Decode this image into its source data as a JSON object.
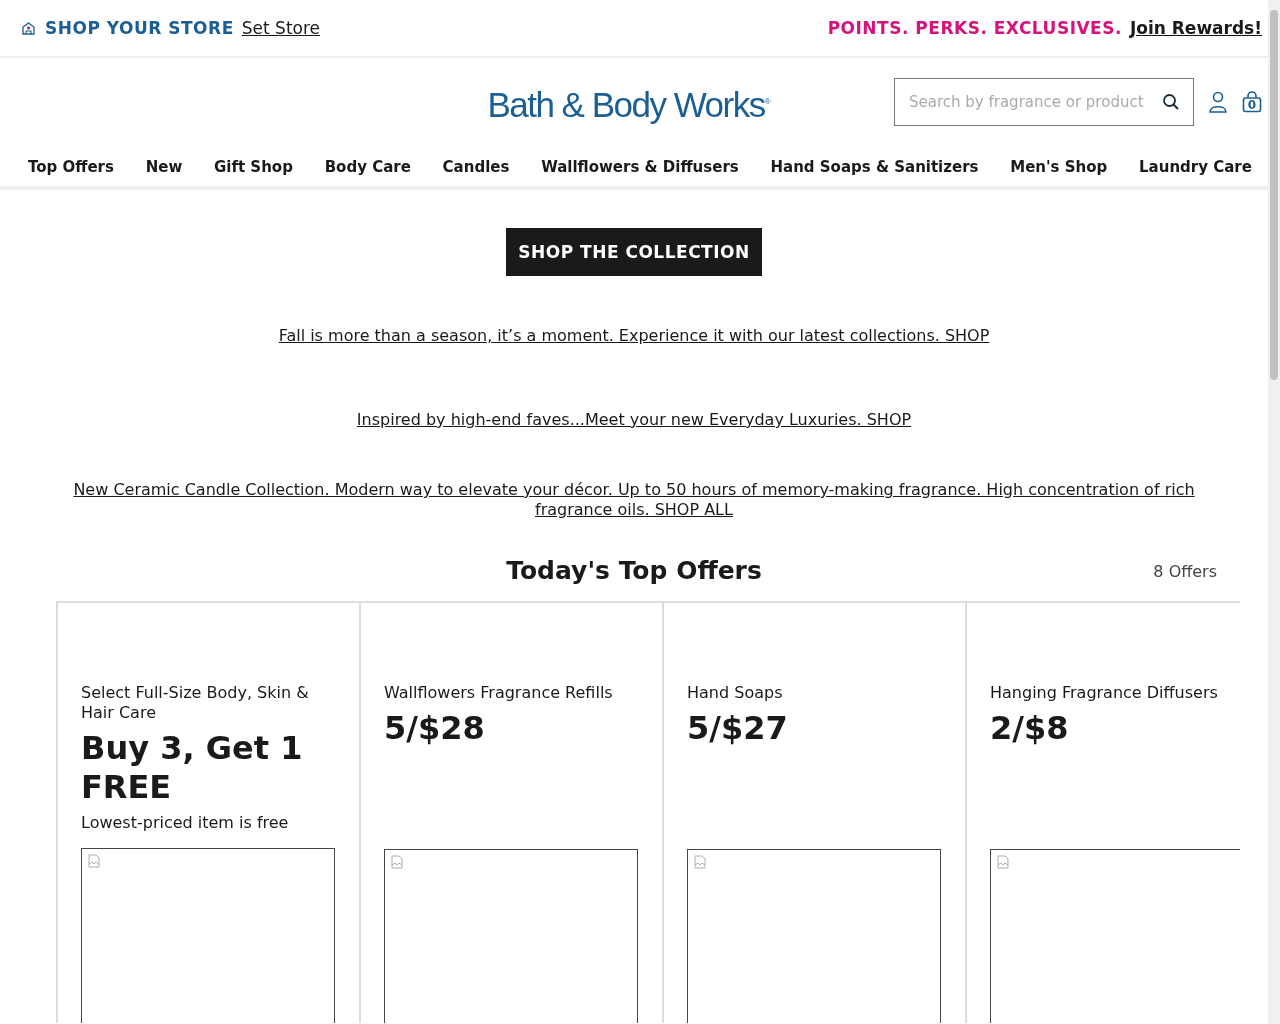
{
  "top_bar": {
    "store_label": "SHOP YOUR STORE",
    "store_link": "Set Store",
    "rewards_label": "POINTS. PERKS. EXCLUSIVES.",
    "rewards_link": "Join Rewards!"
  },
  "header": {
    "logo": "Bath & Body Works",
    "logo_mark": "®",
    "search": {
      "placeholder": "Search by fragrance or product"
    },
    "cart_count": "0"
  },
  "nav": [
    "Top Offers",
    "New",
    "Gift Shop",
    "Body Care",
    "Candles",
    "Wallflowers & Diffusers",
    "Hand Soaps & Sanitizers",
    "Men's Shop",
    "Laundry Care"
  ],
  "cta_button": "SHOP THE COLLECTION",
  "promo_links": [
    "Fall is more than a season, it’s a moment. Experience it with our latest collections. SHOP",
    "Inspired by high-end faves...Meet your new Everyday Luxuries. SHOP",
    "New Ceramic Candle Collection. Modern way to elevate your décor. Up to 50 hours of memory-making fragrance. High concentration of rich fragrance oils. SHOP ALL"
  ],
  "offers": {
    "title": "Today's Top Offers",
    "count": "8 Offers",
    "cards": [
      {
        "category": "Select Full-Size Body, Skin & Hair Care",
        "deal": "Buy 3, Get 1 FREE",
        "note": "Lowest-priced item is free"
      },
      {
        "category": "Wallflowers Fragrance Refills",
        "deal": "5/$28"
      },
      {
        "category": "Hand Soaps",
        "deal": "5/$27"
      },
      {
        "category": "Hanging Fragrance Diffusers",
        "deal": "2/$8"
      }
    ]
  }
}
